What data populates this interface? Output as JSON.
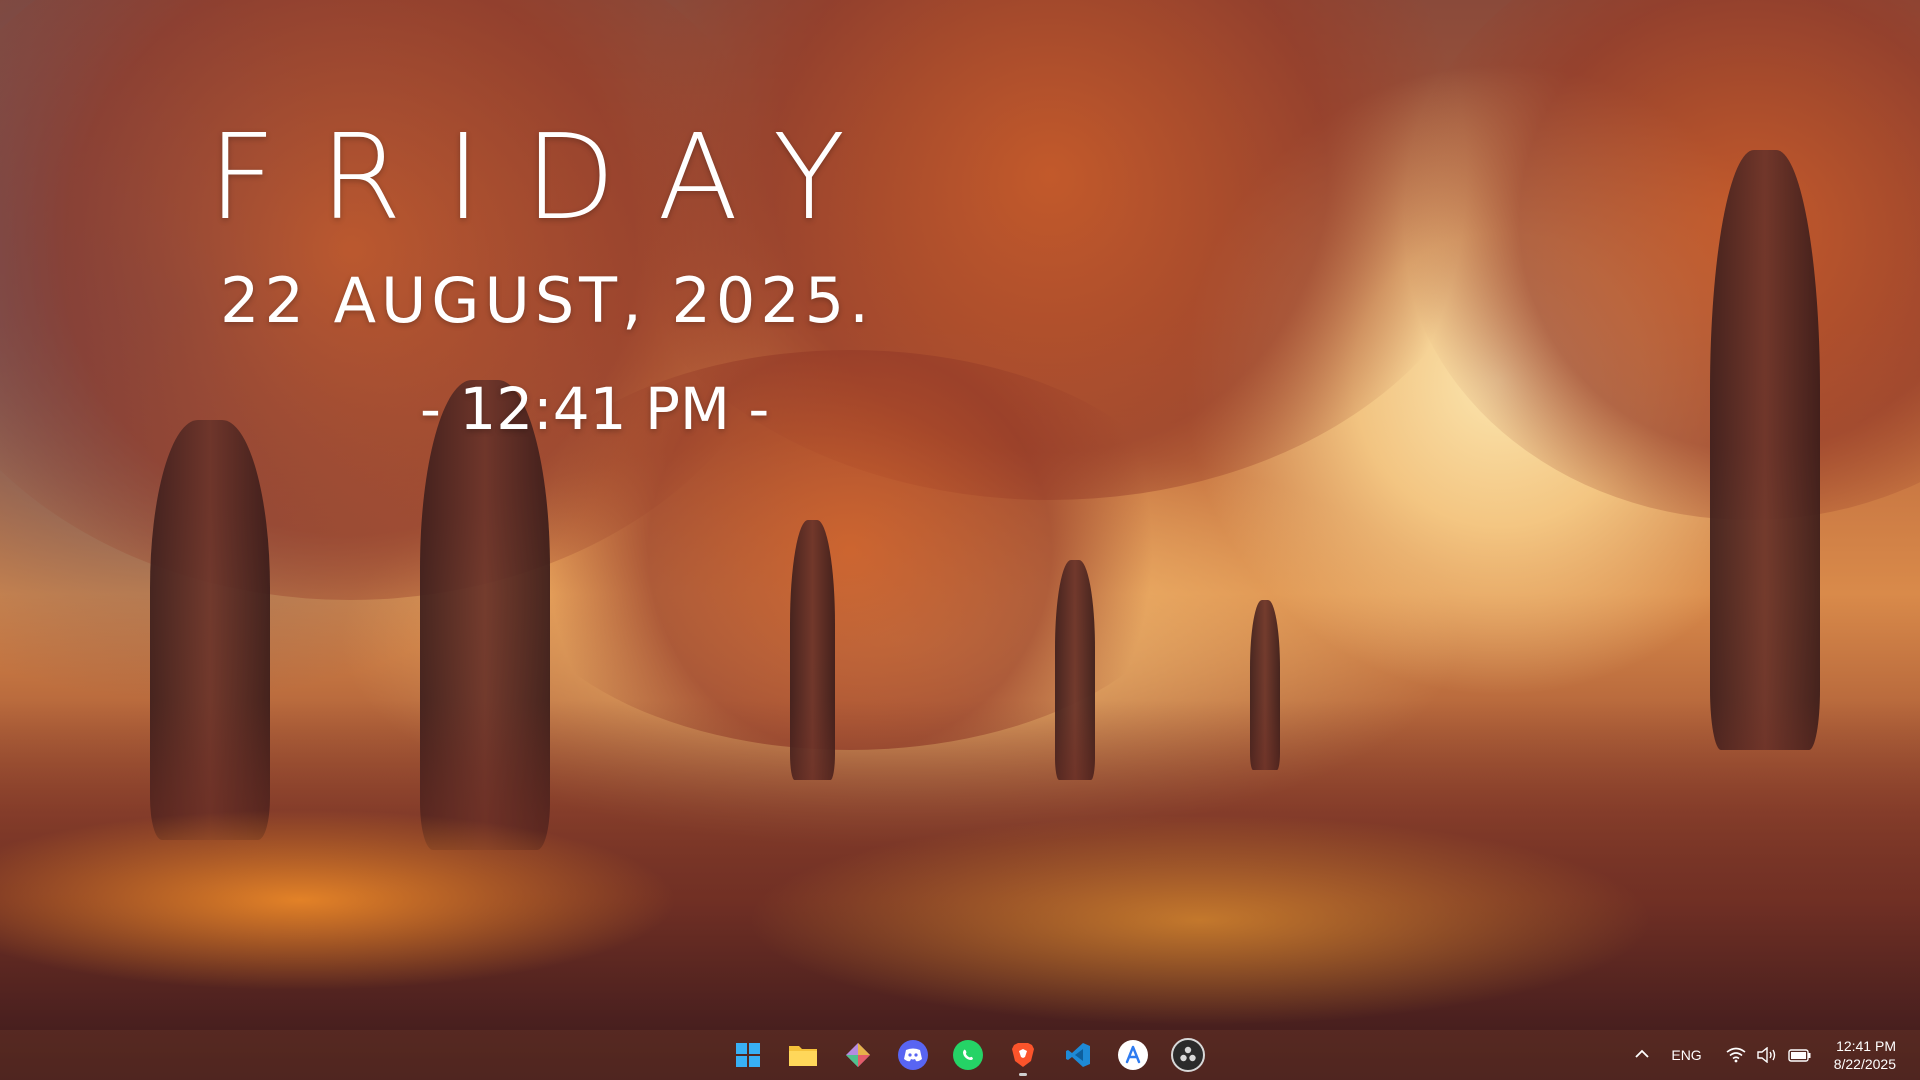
{
  "widget": {
    "day": "FRIDAY",
    "date": "22 AUGUST, 2025.",
    "time": "- 12:41 PM -"
  },
  "taskbar": {
    "apps": [
      {
        "name": "start",
        "icon": "windows-logo-icon",
        "color": "#2aa0f0"
      },
      {
        "name": "file-explorer",
        "icon": "folder-icon",
        "color": "#f5c23a"
      },
      {
        "name": "git-kraken",
        "icon": "diamond-icon",
        "color": "#9a7ad8"
      },
      {
        "name": "discord",
        "icon": "discord-icon",
        "color": "#5865f2"
      },
      {
        "name": "whatsapp",
        "icon": "whatsapp-icon",
        "color": "#25d366"
      },
      {
        "name": "brave",
        "icon": "brave-lion-icon",
        "color": "#fb542b"
      },
      {
        "name": "vscode",
        "icon": "vscode-icon",
        "color": "#1e8ad6"
      },
      {
        "name": "app-store",
        "icon": "app-store-icon",
        "color": "#2d7bf0"
      },
      {
        "name": "obs",
        "icon": "obs-icon",
        "color": "#3b3b3b"
      }
    ],
    "running_app": "brave",
    "tray": {
      "language": "ENG",
      "time": "12:41 PM",
      "date": "8/22/2025"
    }
  }
}
